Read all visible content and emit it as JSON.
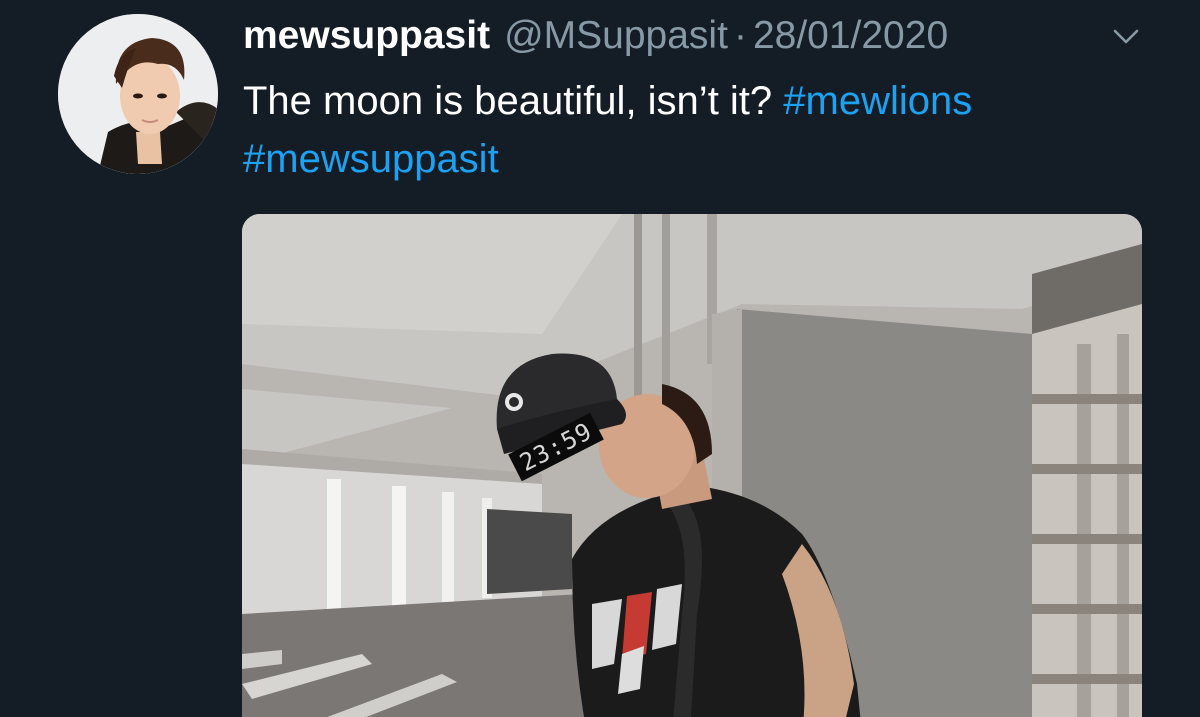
{
  "tweet": {
    "display_name": "mewsuppasit",
    "handle": "@MSuppasit",
    "separator": "·",
    "date": "28/01/2020",
    "text_main": "The moon is beautiful, isn’t it? ",
    "hashtags": [
      "#mewlions",
      "#mewsuppasit"
    ],
    "menu_icon": "chevron-down-icon"
  },
  "media": {
    "overlay_text": "23:59",
    "description_icon": "photo"
  },
  "colors": {
    "background": "#141d26",
    "primary_text": "#ffffff",
    "secondary_text": "#8899a6",
    "link": "#1da1f2"
  }
}
